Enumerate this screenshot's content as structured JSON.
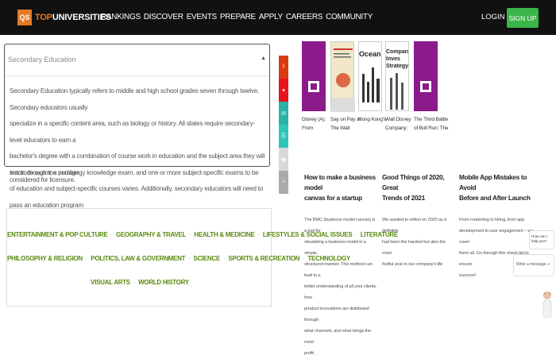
{
  "header": {
    "logo_box": "QS",
    "logo_top": "TOP",
    "logo_rest": "UNIVERSITIES",
    "nav": [
      "RANKINGS",
      "DISCOVER",
      "EVENTS",
      "PREPARE",
      "APPLY",
      "CAREERS",
      "COMMUNITY"
    ],
    "login": "LOGIN",
    "signup": "SIGN UP"
  },
  "accordion": {
    "title": "Secondary Education",
    "caret": "▲",
    "lines": [
      "Secondary Education typically refers to middle and high school grades seven through twelve. Secondary educators usually",
      "specialize in a specific content area, such as biology or history. All states require secondary-level educators to earn a",
      "bachelor's degree with a combination of course work in education and the subject area they will teach, though the number",
      "of education and subject-specific courses varies. Additionally, secondary educators will need to pass an education program"
    ],
    "tail": "entrance exam, a pedagogy knowledge exam, and one or more subject-specific exams to be considered for licensure."
  },
  "topics": {
    "rows": [
      [
        "ENTERTAINMENT & POP CULTURE",
        "GEOGRAPHY & TRAVEL",
        "HEALTH & MEDICINE",
        "LIFESTYLES & SOCIAL ISSUES",
        "LITERATURE"
      ],
      [
        "PHILOSOPHY & RELIGION",
        "POLITICS, LAW & GOVERNMENT",
        "SCIENCE",
        "SPORTS & RECREATION",
        "TECHNOLOGY"
      ],
      [
        "VISUAL ARTS",
        "WORLD HISTORY"
      ]
    ],
    "separator": "·"
  },
  "books": [
    {
      "caption": [
        "Disney (A):",
        "From"
      ],
      "color": "#8b1a8b",
      "cover_text": ""
    },
    {
      "caption": [
        "Say on Pay at",
        "The Walt"
      ],
      "color": "#f2e8c8",
      "cover_text": ""
    },
    {
      "caption": [
        "",
        "",
        "",
        "Hong Kong's"
      ],
      "color": "#222222",
      "cover_text": "Ocean Park Tal"
    },
    {
      "caption": [
        "Walt Disney",
        "Company:"
      ],
      "color": "#ffffff",
      "cover_text": "Company Inves Strategy"
    },
    {
      "caption": [
        "The Third Battle",
        "of Bull Run: The"
      ],
      "color": "#8b1a8b",
      "cover_text": ""
    }
  ],
  "articles": [
    {
      "title": [
        "How to make a business model",
        "canvas for a startup"
      ],
      "text": [
        "The BMC (business model canvas) is a tool for",
        "visualizing a business model in a simple,",
        "structured manner. This method can lead to a",
        "better understanding of all your clients, how",
        "product innovations are distributed through",
        "what channels, and what brings the most",
        "profit."
      ]
    },
    {
      "title": [
        "Good Things of 2020, Great",
        "Trends of 2021"
      ],
      "text": [
        "We wanted to reflect on 2020 as it definitely",
        "had been the hardest but also the most",
        "fruitful year in our company's life"
      ]
    },
    {
      "title": [
        "Mobile App Mistakes to Avoid",
        "Before and After Launch"
      ],
      "text": [
        "From marketing to hiring, from app",
        "development to user engagement – we cover",
        "them all. Go through this check-list to ensure",
        "success!"
      ]
    }
  ],
  "chat": {
    "bubble": "How can I help you?",
    "placeholder": "Write a message...",
    "send": "›"
  },
  "colors": {
    "accent": "#e77923",
    "signup": "#3ab54a",
    "topic": "#5a8a10",
    "share": [
      "#d93a12",
      "#e8131d",
      "#29b3a8",
      "#2fc4ba",
      "#d8d8d8",
      "#aaaaaa"
    ]
  }
}
